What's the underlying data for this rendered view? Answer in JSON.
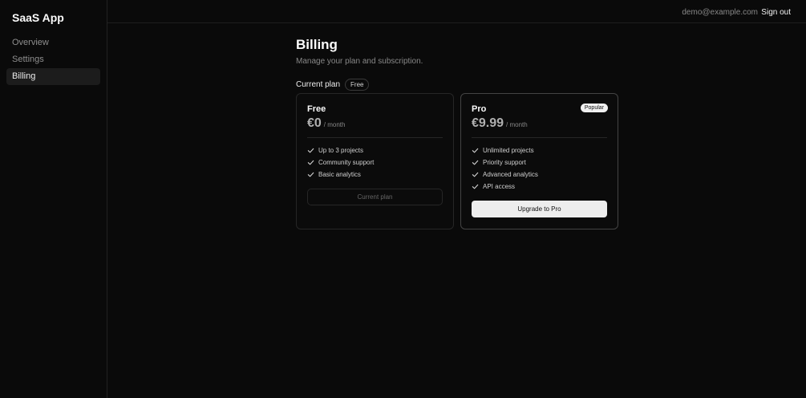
{
  "app": {
    "title": "SaaS App"
  },
  "sidebar": {
    "items": [
      {
        "label": "Overview"
      },
      {
        "label": "Settings"
      },
      {
        "label": "Billing"
      }
    ]
  },
  "topbar": {
    "email": "demo@example.com",
    "signout_label": "Sign out"
  },
  "billing": {
    "title": "Billing",
    "subtitle": "Manage your plan and subscription.",
    "current_plan_label": "Current plan",
    "current_plan_badge": "Free",
    "plans": [
      {
        "name": "Free",
        "price": "€0",
        "period": "/ month",
        "features": [
          "Up to 3 projects",
          "Community support",
          "Basic analytics"
        ],
        "button_label": "Current plan"
      },
      {
        "name": "Pro",
        "badge": "Popular",
        "price": "€9.99",
        "period": "/ month",
        "features": [
          "Unlimited projects",
          "Priority support",
          "Advanced analytics",
          "API access"
        ],
        "button_label": "Upgrade to Pro"
      }
    ]
  }
}
